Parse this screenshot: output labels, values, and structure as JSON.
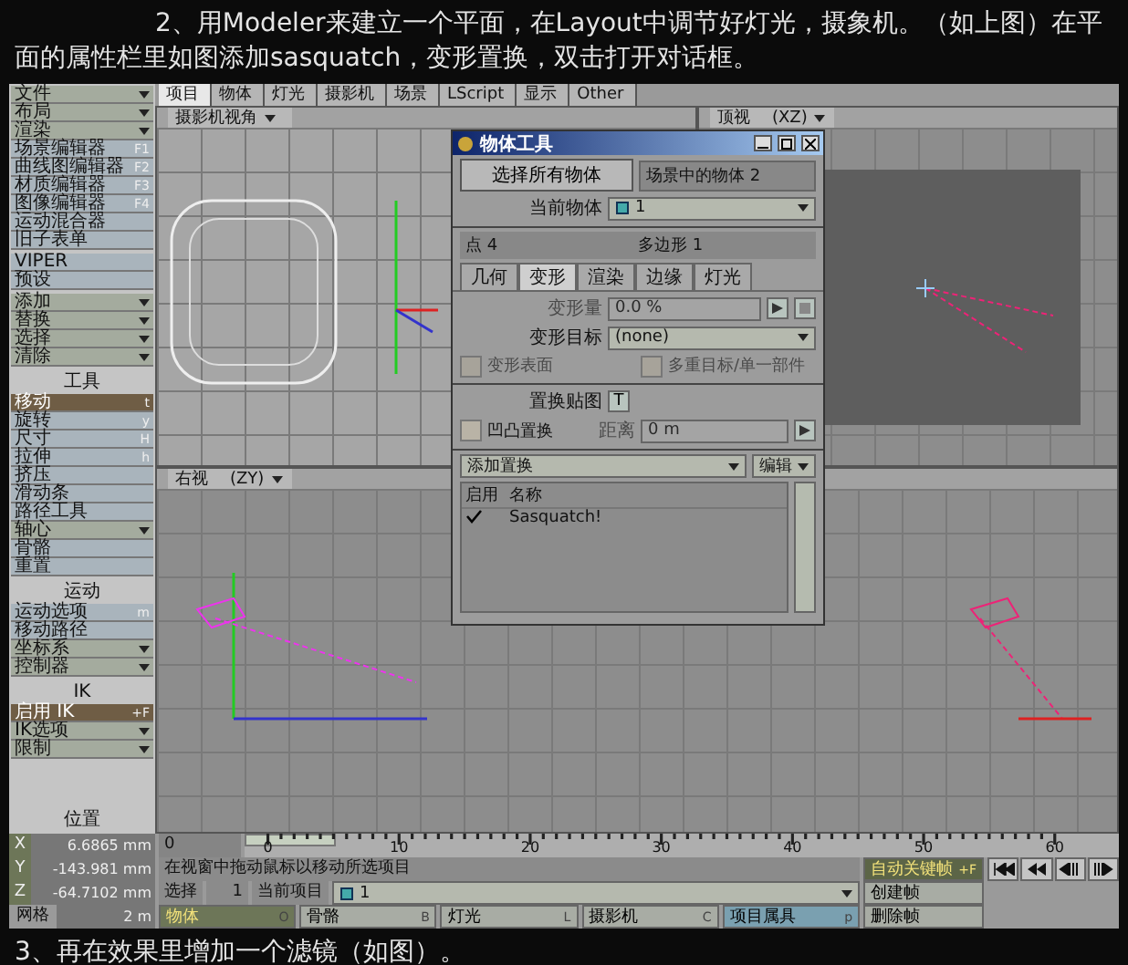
{
  "article": {
    "intro": "2、用Modeler来建立一个平面，在Layout中调节好灯光，摄象机。（如上图）在平面的属性栏里如图添加sasquatch，变形置换，双击打开对话框。",
    "next_step": "3、再在效果里增加一个滤镜（如图）。"
  },
  "toolbar_tabs": [
    {
      "label": "项目",
      "selected": true
    },
    {
      "label": "物体",
      "selected": false
    },
    {
      "label": "灯光",
      "selected": false
    },
    {
      "label": "摄影机",
      "selected": false
    },
    {
      "label": "场景",
      "selected": false
    },
    {
      "label": "LScript",
      "selected": false
    },
    {
      "label": "显示",
      "selected": false
    },
    {
      "label": "Other",
      "selected": false
    }
  ],
  "sidebar": {
    "groups": [
      {
        "items": [
          {
            "label": "文件",
            "kind": "dropdown",
            "selected": false
          },
          {
            "label": "布局",
            "kind": "dropdown",
            "selected": false
          },
          {
            "label": "渲染",
            "kind": "dropdown",
            "selected": false
          },
          {
            "label": "场景编辑器",
            "kind": "button",
            "hotkey": "F1",
            "selected": false
          },
          {
            "label": "曲线图编辑器",
            "kind": "button",
            "hotkey": "F2",
            "selected": false
          },
          {
            "label": "材质编辑器",
            "kind": "button",
            "hotkey": "F3",
            "selected": false
          },
          {
            "label": "图像编辑器",
            "kind": "button",
            "hotkey": "F4",
            "selected": false
          },
          {
            "label": "运动混合器",
            "kind": "button",
            "selected": false
          },
          {
            "label": "旧子表单",
            "kind": "button",
            "selected": false
          }
        ]
      },
      {
        "items": [
          {
            "label": "VIPER",
            "kind": "button",
            "selected": false
          },
          {
            "label": "预设",
            "kind": "button",
            "selected": false
          }
        ]
      },
      {
        "items": [
          {
            "label": "添加",
            "kind": "dropdown",
            "selected": false
          },
          {
            "label": "替换",
            "kind": "dropdown",
            "selected": false
          },
          {
            "label": "选择",
            "kind": "dropdown",
            "selected": false
          },
          {
            "label": "清除",
            "kind": "dropdown",
            "selected": false
          }
        ]
      },
      {
        "title": "工具",
        "items": [
          {
            "label": "移动",
            "kind": "button",
            "hotkey": "t",
            "selected": true
          },
          {
            "label": "旋转",
            "kind": "button",
            "hotkey": "y",
            "selected": false
          },
          {
            "label": "尺寸",
            "kind": "button",
            "hotkey": "H",
            "selected": false
          },
          {
            "label": "拉伸",
            "kind": "button",
            "hotkey": "h",
            "selected": false
          },
          {
            "label": "挤压",
            "kind": "button",
            "selected": false
          },
          {
            "label": "滑动条",
            "kind": "button",
            "selected": false
          },
          {
            "label": "路径工具",
            "kind": "button",
            "selected": false
          },
          {
            "label": "轴心",
            "kind": "dropdown",
            "selected": false
          },
          {
            "label": "骨骼",
            "kind": "button",
            "selected": false
          },
          {
            "label": "重置",
            "kind": "button",
            "selected": false
          }
        ]
      },
      {
        "title": "运动",
        "items": [
          {
            "label": "运动选项",
            "kind": "button",
            "hotkey": "m",
            "selected": false
          },
          {
            "label": "移动路径",
            "kind": "button",
            "selected": false
          },
          {
            "label": "坐标系",
            "kind": "dropdown",
            "selected": false
          },
          {
            "label": "控制器",
            "kind": "dropdown",
            "selected": false
          }
        ]
      },
      {
        "title": "IK",
        "items": [
          {
            "label": "启用 IK",
            "kind": "button",
            "hotkey": "+F",
            "selected": true
          },
          {
            "label": "IK选项",
            "kind": "dropdown",
            "selected": false
          },
          {
            "label": "限制",
            "kind": "dropdown",
            "selected": false
          }
        ]
      }
    ],
    "position_title": "位置"
  },
  "viewports": [
    {
      "kind": "camera",
      "view": "摄影机视角"
    },
    {
      "kind": "top",
      "view": "顶视",
      "axes": "(XZ)"
    },
    {
      "kind": "right",
      "view": "右视",
      "axes": "(ZY)"
    }
  ],
  "dialog": {
    "title": "物体工具",
    "select_all": "选择所有物体",
    "scene_count": "场景中的物体 2",
    "current_label": "当前物体",
    "current_object": "1",
    "points": "点 4",
    "polygons": "多边形 1",
    "tabs": [
      {
        "label": "几何",
        "selected": false
      },
      {
        "label": "变形",
        "selected": true
      },
      {
        "label": "渲染",
        "selected": false
      },
      {
        "label": "边缘",
        "selected": false
      },
      {
        "label": "灯光",
        "selected": false
      }
    ],
    "morph_amount_label": "变形量",
    "morph_amount": "0.0 %",
    "morph_target_label": "变形目标",
    "morph_target": "(none)",
    "morph_surfaces": {
      "label": "变形表面",
      "checked": false,
      "disabled": true
    },
    "multi_target": {
      "label": "多重目标/单一部件",
      "checked": false,
      "disabled": true
    },
    "displacement_label": "置换贴图",
    "displacement_button": "T",
    "bump": {
      "label": "凹凸置换",
      "checked": false,
      "disabled": false
    },
    "distance_label": "距离",
    "distance": "0 m",
    "add_displacement": "添加置换",
    "edit": "编辑",
    "columns": [
      "启用",
      "名称"
    ],
    "plugins": [
      {
        "enabled": true,
        "name": "Sasquatch!"
      }
    ]
  },
  "bottom": {
    "coords": [
      {
        "axis": "X",
        "value": "6.6865 mm"
      },
      {
        "axis": "Y",
        "value": "-143.981 mm"
      },
      {
        "axis": "Z",
        "value": "-64.7102 mm"
      }
    ],
    "grid_label": "网格",
    "grid_value": "2 m",
    "frame": "0",
    "ticks": [
      "0",
      "10",
      "20",
      "30",
      "40",
      "50",
      "60"
    ],
    "message": "在视窗中拖动鼠标以移动所选项目",
    "selection_label": "选择",
    "selection_count": "1",
    "current_item_label": "当前项目",
    "current_item": "1",
    "item_types": [
      {
        "label": "物体",
        "hotkey": "O",
        "selected": true
      },
      {
        "label": "骨骼",
        "hotkey": "B",
        "selected": false
      },
      {
        "label": "灯光",
        "hotkey": "L",
        "selected": false
      },
      {
        "label": "摄影机",
        "hotkey": "C",
        "selected": false
      },
      {
        "label": "项目属具",
        "hotkey": "p",
        "selected": false
      }
    ],
    "auto_key": {
      "label": "自动关键帧",
      "hotkey": "+F",
      "on": true
    },
    "create_key": "创建帧",
    "delete_key": "删除帧"
  }
}
